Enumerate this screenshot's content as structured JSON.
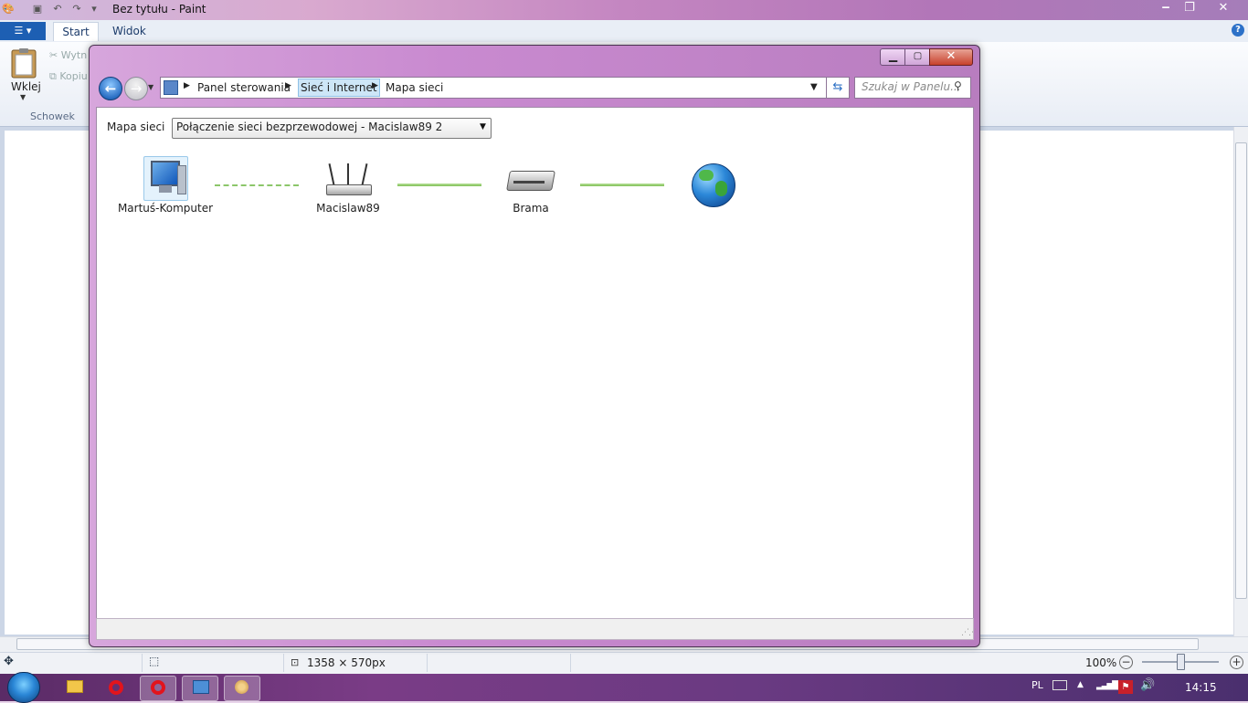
{
  "paint": {
    "window_title": "Bez tytułu - Paint",
    "file_menu_icon": "menu-icon",
    "tabs": [
      "Start",
      "Widok"
    ],
    "ribbon": {
      "paste_label": "Wklej",
      "cut_label": "Wytn",
      "copy_label": "Kopiu",
      "group_label": "Schowek"
    },
    "status": {
      "image_size": "1358 × 570px",
      "zoom": "100%"
    }
  },
  "network_window": {
    "breadcrumb": [
      "Panel sterowania",
      "Sieć i Internet",
      "Mapa sieci"
    ],
    "search_placeholder": "Szukaj w Panelu...",
    "map_label": "Mapa sieci",
    "connection_selected": "Połączenie sieci bezprzewodowej - Macislaw89  2",
    "nodes": [
      {
        "label": "Martuś-Komputer",
        "icon": "computer-icon"
      },
      {
        "label": "Macislaw89",
        "icon": "router-icon"
      },
      {
        "label": "Brama",
        "icon": "gateway-icon"
      },
      {
        "label": "",
        "icon": "internet-globe-icon"
      }
    ],
    "links": [
      {
        "from": "Martuś-Komputer",
        "to": "Macislaw89",
        "style": "wireless-dashed"
      },
      {
        "from": "Macislaw89",
        "to": "Brama",
        "style": "wired-solid"
      },
      {
        "from": "Brama",
        "to": "Internet",
        "style": "wired-solid"
      }
    ]
  },
  "taskbar": {
    "items": [
      "windows-explorer",
      "opera",
      "opera",
      "control-panel",
      "paint"
    ],
    "tray": {
      "language": "PL",
      "clock": "14:15"
    }
  },
  "colors": {
    "accent_blue": "#1d5fb3",
    "window_frame": "#c98ad0",
    "link_green": "#8cc66a",
    "taskbar": "#6a3a82"
  }
}
